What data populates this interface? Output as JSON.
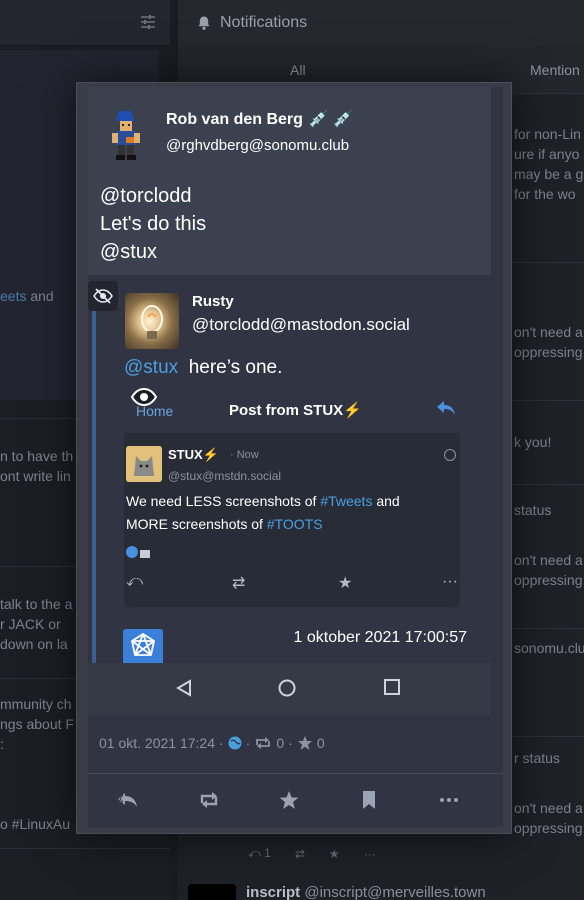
{
  "background": {
    "column_title": "Notifications",
    "tabs": [
      "All",
      "Mention"
    ],
    "left_snippets": [
      {
        "text": "eets",
        "link": true,
        "suffix": " and"
      },
      {
        "text": "n to have th"
      },
      {
        "text": "ont write lin"
      },
      {
        "text": "talk to the a"
      },
      {
        "text": "r JACK or"
      },
      {
        "text": "down on la"
      },
      {
        "text": "mmunity ch"
      },
      {
        "text": "ngs about F"
      },
      {
        "text": ":"
      },
      {
        "text": "o #LinuxAu"
      }
    ],
    "right_snippets": [
      "for non-Lin",
      "ure if anyo",
      "may be a g",
      "for the wo",
      "on't need a",
      "oppressing",
      "k you!",
      "status",
      "on't need a",
      "oppressing",
      "sonomu.club",
      "r status",
      "on't need a",
      "oppressing"
    ],
    "footer_reply_count": "1",
    "next_author_name": "inscript",
    "next_author_acct": "@inscript@merveilles.town"
  },
  "status": {
    "display_name": "Rob van den Berg",
    "name_emoji": "💉 💉",
    "acct": "@rghvdberg@sonomu.club",
    "content": [
      "@torclodd",
      "Let's do this",
      "@stux"
    ],
    "quoted": {
      "display_name": "Rusty",
      "acct": "@torclodd@mastodon.social",
      "mention": "@stux",
      "text": "here’s one.",
      "screenshot": {
        "home_label": "Home",
        "title": "Post from STUX⚡",
        "author": "STUX⚡",
        "time": "· Now",
        "acct": "@stux@mstdn.social",
        "line1_pre": "We need LESS screenshots of ",
        "line1_tag": "#Tweets",
        "line1_post": " and",
        "line2_pre": "MORE screenshots of ",
        "line2_tag": "#TOOTS"
      },
      "timestamp": "1 oktober 2021 17:00:57"
    },
    "meta_date": "01 okt. 2021 17:24",
    "meta_sep": "·",
    "reblogs": "0",
    "favourites": "0"
  },
  "colors": {
    "accent": "#4a9fe0",
    "panel": "#313543",
    "modal": "#3a3d48"
  },
  "icons": [
    "tune-icon",
    "bell-icon",
    "eye-off-icon",
    "eye-icon",
    "globe-icon",
    "retweet-icon",
    "star-icon",
    "reply-all-icon",
    "bookmark-icon",
    "more-icon"
  ]
}
